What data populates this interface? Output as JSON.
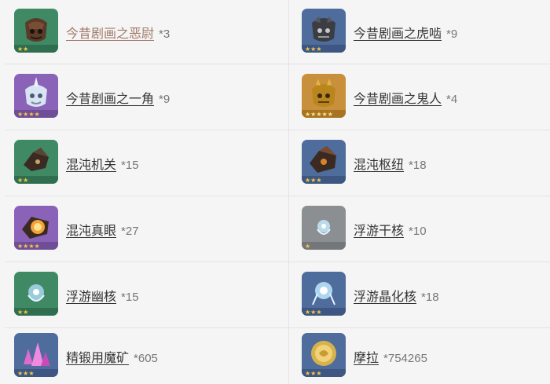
{
  "items": [
    {
      "name": "今昔剧画之恶尉",
      "count": "*3",
      "bg": "#3f8a65",
      "rarity": 2,
      "icon": "mask-dark-icon"
    },
    {
      "name": "今昔剧画之虎啮",
      "count": "*9",
      "bg": "#4e6c9c",
      "rarity": 3,
      "icon": "mask-tiger-icon"
    },
    {
      "name": "今昔剧画之一角",
      "count": "*9",
      "bg": "#8a62b8",
      "rarity": 4,
      "icon": "mask-horn-icon"
    },
    {
      "name": "今昔剧画之鬼人",
      "count": "*4",
      "bg": "#c8903a",
      "rarity": 5,
      "icon": "mask-oni-icon"
    },
    {
      "name": "混沌机关",
      "count": "*15",
      "bg": "#3f8a65",
      "rarity": 2,
      "icon": "chaos-device-icon"
    },
    {
      "name": "混沌枢纽",
      "count": "*18",
      "bg": "#4e6c9c",
      "rarity": 3,
      "icon": "chaos-circuit-icon"
    },
    {
      "name": "混沌真眼",
      "count": "*27",
      "bg": "#8a62b8",
      "rarity": 4,
      "icon": "chaos-core-icon"
    },
    {
      "name": "浮游干核",
      "count": "*10",
      "bg": "#8c8f92",
      "rarity": 1,
      "icon": "mist-grass-icon"
    },
    {
      "name": "浮游幽核",
      "count": "*15",
      "bg": "#3f8a65",
      "rarity": 2,
      "icon": "mist-pollen-icon"
    },
    {
      "name": "浮游晶化核",
      "count": "*18",
      "bg": "#4e6c9c",
      "rarity": 3,
      "icon": "mist-crystal-icon"
    },
    {
      "name": "精锻用魔矿",
      "count": "*605",
      "bg": "#4e6c9c",
      "rarity": 3,
      "icon": "enhancement-ore-icon"
    },
    {
      "name": "摩拉",
      "count": "*754265",
      "bg": "#4e6c9c",
      "rarity": 3,
      "icon": "mora-coin-icon"
    }
  ]
}
